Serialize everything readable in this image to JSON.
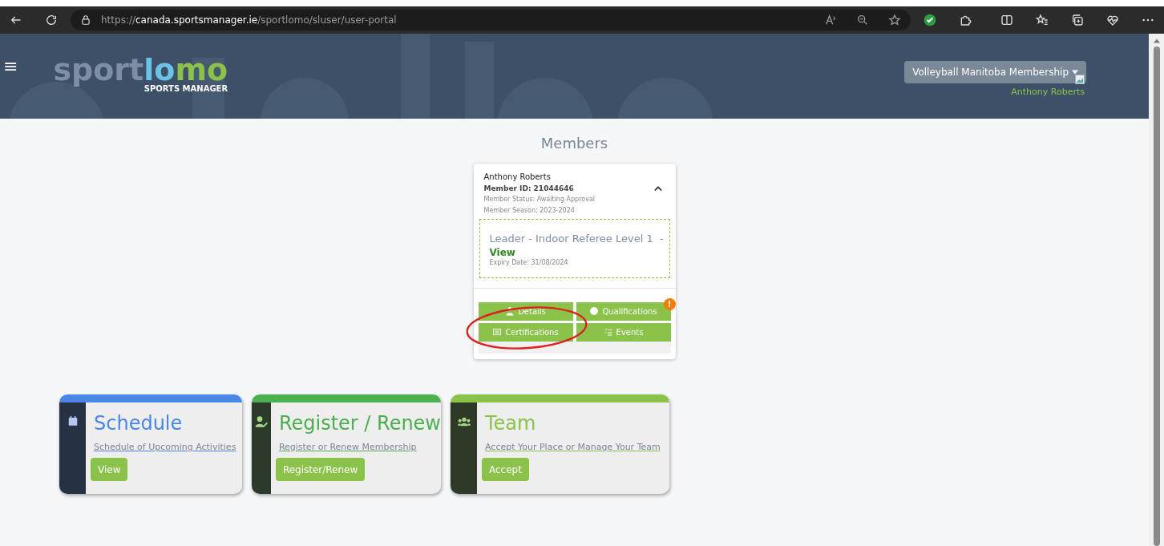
{
  "browser": {
    "url_prefix": "https://",
    "url_host": "canada.sportsmanager.ie",
    "url_path": "/sportlomo/sluser/user-portal"
  },
  "header": {
    "logo_part_1": "sport",
    "logo_part_2": "lo",
    "logo_part_3": "mo",
    "logo_subtitle": "SPORTS MANAGER",
    "menu_glyph": "≡",
    "org_dropdown": "Volleyball Manitoba Membership",
    "user_name": "Anthony Roberts"
  },
  "page_title": "Members",
  "member": {
    "name": "Anthony Roberts",
    "member_id": "Member ID: 21044646",
    "status": "Member Status: Awaiting Approval",
    "season": "Member Season: 2023-2024",
    "expanded": true,
    "qualification": {
      "title": "Leader - Indoor Referee Level 1  -",
      "link": "View",
      "expiry": "Expiry Date: 31/08/2024"
    },
    "buttons": [
      {
        "kind": "details",
        "label": "Details"
      },
      {
        "kind": "qualifications",
        "label": "Qualifications",
        "alert": "!"
      },
      {
        "kind": "certifications",
        "label": "Certifications"
      },
      {
        "kind": "events",
        "label": "Events"
      }
    ]
  },
  "cards": [
    {
      "kind": "schedule",
      "color": "#4a86e8",
      "title": "Schedule",
      "subtitle": "Schedule of Upcoming Activities",
      "button": "View"
    },
    {
      "kind": "register",
      "color": "#4caf50",
      "title": "Register / Renew",
      "subtitle": "Register or Renew Membership",
      "button": "Register/Renew"
    },
    {
      "kind": "team",
      "color": "#8bc34a",
      "title": "Team",
      "subtitle": "Accept Your Place or Manage Your Team",
      "button": "Accept"
    }
  ]
}
